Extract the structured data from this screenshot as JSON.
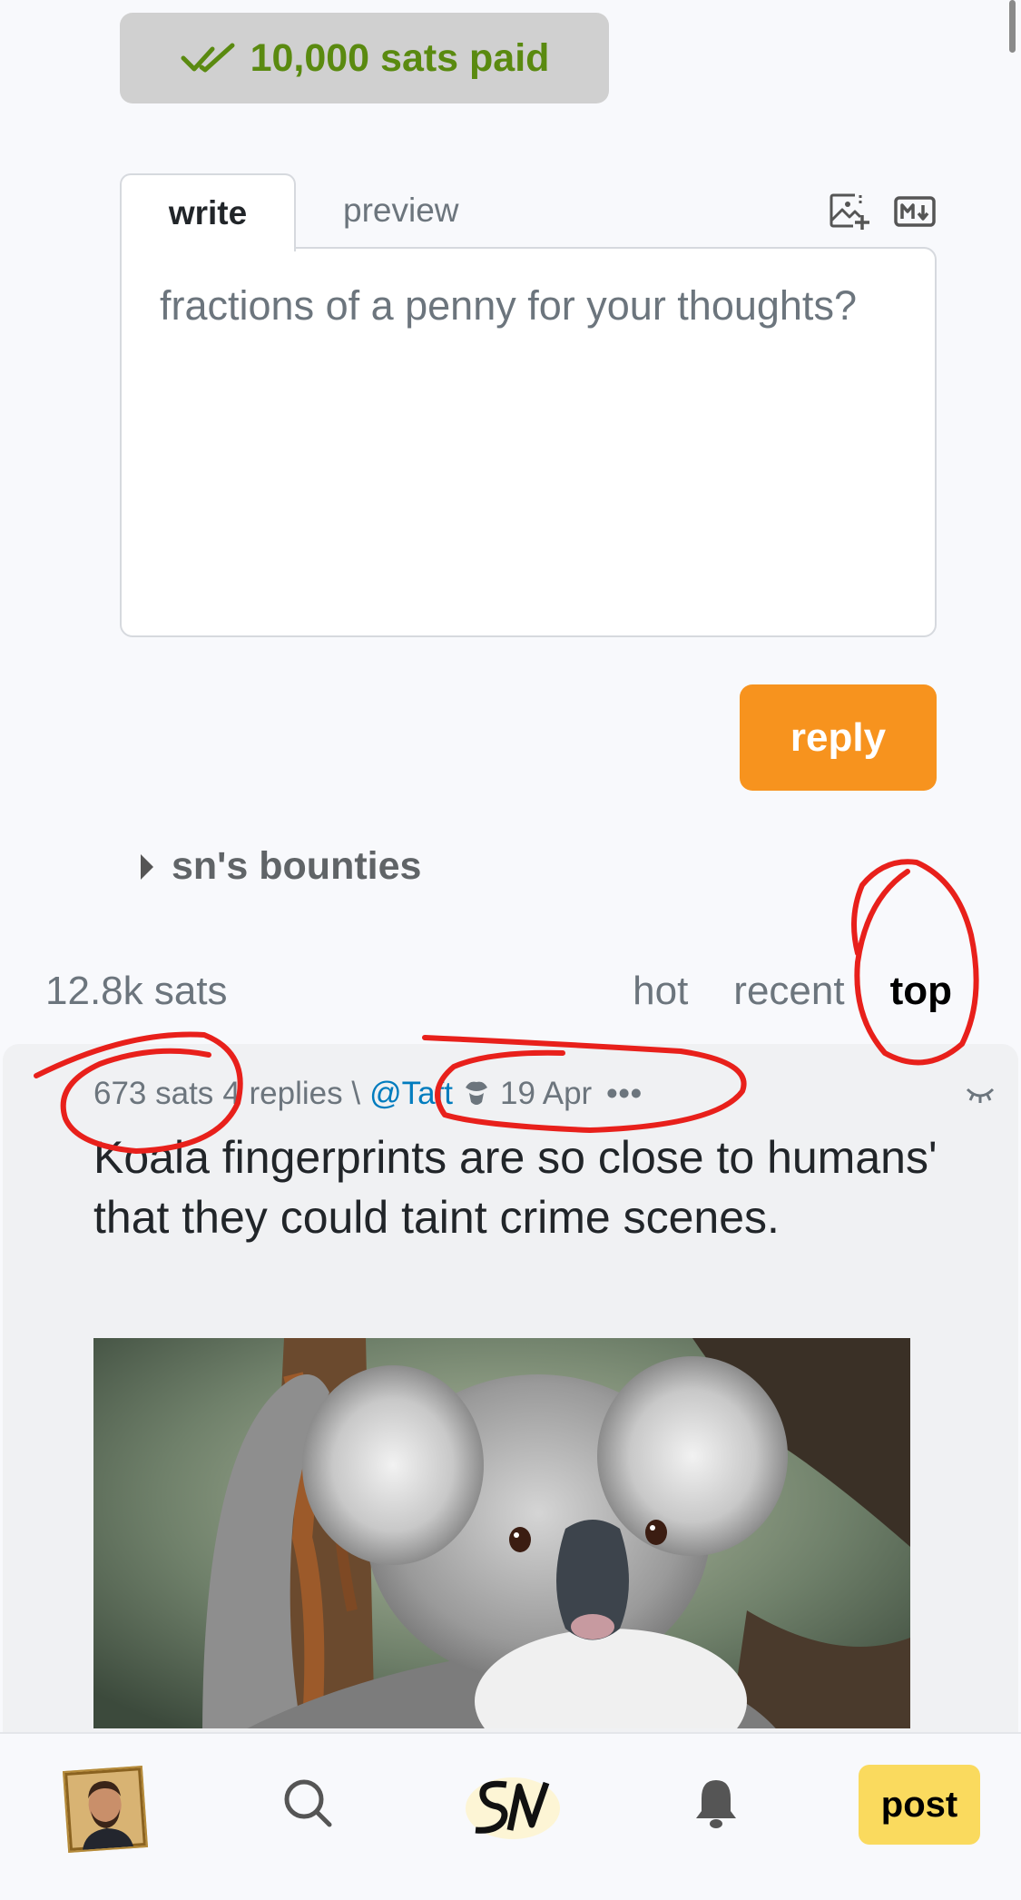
{
  "paid_badge": {
    "label": "10,000 sats paid",
    "icon": "double-check-icon",
    "color": "#5a8a10"
  },
  "editor": {
    "tabs": {
      "write": "write",
      "preview": "preview"
    },
    "placeholder": "fractions of a penny for your thoughts?",
    "toolbar_icons": [
      "image-upload-icon",
      "markdown-icon"
    ]
  },
  "reply_button": "reply",
  "bounties_label": "sn's bounties",
  "comments_header": {
    "total_sats": "12.8k sats",
    "sort": [
      "hot",
      "recent",
      "top"
    ],
    "active_sort": "top"
  },
  "post": {
    "sats": "673 sats",
    "replies": "4 replies \\",
    "user": "@Taft",
    "date": "19 Apr",
    "title": "Koala fingerprints are so close to humans' that they could taint crime scenes.",
    "image_alt": "koala on a tree"
  },
  "nav": {
    "post_label": "post",
    "icons": [
      "avatar",
      "search-icon",
      "sn-logo",
      "bell-icon"
    ]
  },
  "colors": {
    "accent_orange": "#f7931e",
    "post_yellow": "#fada5e",
    "link_blue": "#007cbe",
    "annotation_red": "#e8201b"
  }
}
